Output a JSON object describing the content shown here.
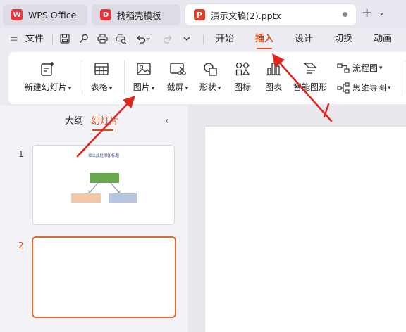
{
  "tabs": {
    "wps": {
      "label": "WPS Office",
      "logo": "W"
    },
    "template": {
      "label": "找稻壳模板",
      "logo": "D"
    },
    "document": {
      "label": "演示文稿(2).pptx",
      "logo": "P"
    },
    "add_icon": "+",
    "chevron": "⌄"
  },
  "menu": {
    "hamburger": "≡",
    "file": "文件",
    "icons": [
      "save-icon",
      "format-painter-icon",
      "print-icon",
      "print-preview-icon",
      "undo-icon",
      "redo-icon",
      "more-icon"
    ],
    "items": [
      "开始",
      "插入",
      "设计",
      "切换",
      "动画"
    ],
    "active": "插入",
    "active_color": "#d24f1b"
  },
  "ribbon": {
    "new_slide": "新建幻灯片",
    "table": "表格",
    "picture": "图片",
    "screenshot": "截屏",
    "shape": "形状",
    "icon": "图标",
    "chart": "图表",
    "smartart": "智能图形",
    "flowchart": "流程图",
    "mindmap": "思维导图"
  },
  "left_panel": {
    "tab_outline": "大纲",
    "tab_slides": "幻灯片",
    "collapse": "‹",
    "slides": [
      {
        "number": "1",
        "title": "单击此处添加标题"
      },
      {
        "number": "2"
      }
    ]
  },
  "accent": "#d24f1b",
  "annotation_color": "#e0241e"
}
